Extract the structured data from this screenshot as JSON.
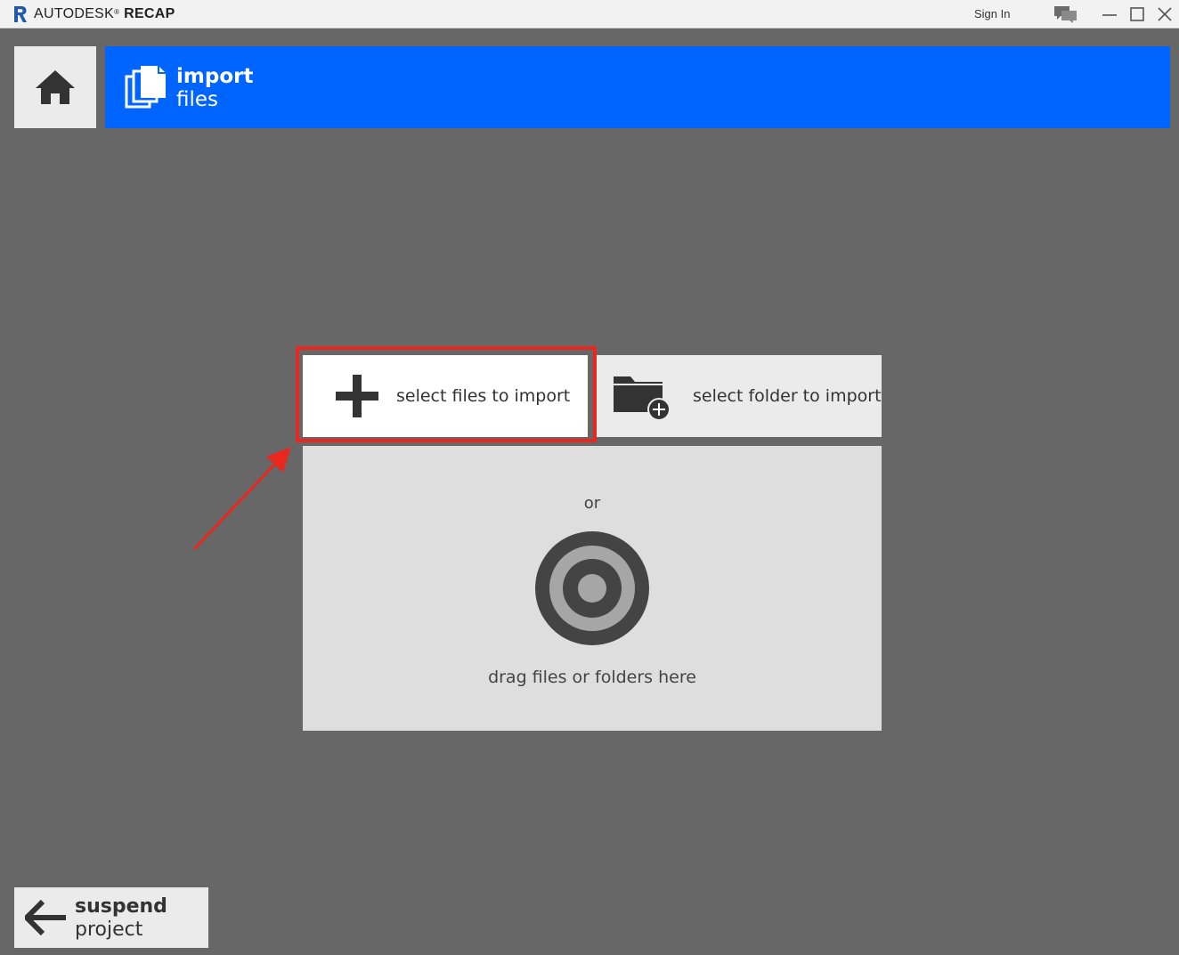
{
  "window": {
    "app_name_prefix": "AUTODESK",
    "app_name_trademark": "®",
    "app_name_product": "RECAP",
    "sign_in_label": "Sign In"
  },
  "header": {
    "title": "import",
    "subtitle": "files",
    "accent_color": "#0064ff"
  },
  "import": {
    "select_files_label": "select files to import",
    "select_folder_label": "select folder to import",
    "or_label": "or",
    "drag_label": "drag files or folders here"
  },
  "footer": {
    "suspend_title": "suspend",
    "suspend_subtitle": "project"
  },
  "icons": {
    "logo": "recap-logo-icon",
    "chat": "chat-icon",
    "minimize": "minimize-icon",
    "maximize": "maximize-icon",
    "close": "close-icon",
    "home": "home-icon",
    "files": "files-icon",
    "plus": "plus-icon",
    "folder_add": "folder-add-icon",
    "target": "target-icon",
    "back_arrow": "arrow-left-icon"
  },
  "annotation": {
    "highlight_color": "#e8281e"
  }
}
